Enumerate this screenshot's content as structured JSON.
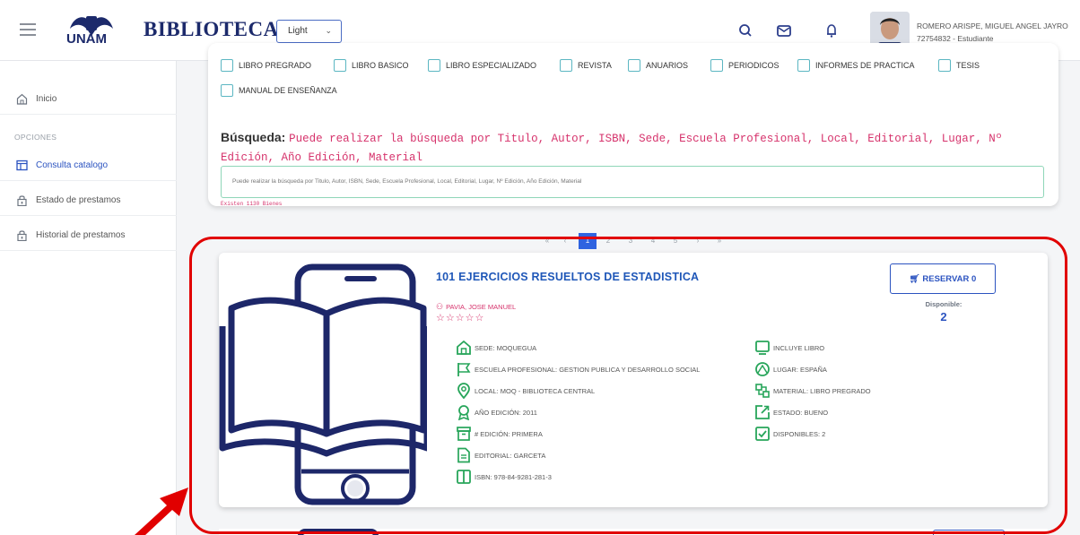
{
  "header": {
    "logo_text": "UNAM",
    "brand": "BIBLIOTECA",
    "theme_select": "Light",
    "user_name": "ROMERO ARISPE, MIGUEL ANGEL JAYRO",
    "user_code": "72754832 - Estudiante"
  },
  "sidebar": {
    "inicio": "Inicio",
    "section": "OPCIONES",
    "items": [
      "Consulta catalogo",
      "Estado de prestamos",
      "Historial de prestamos"
    ]
  },
  "filters": {
    "checkboxes": [
      "LIBRO PREGRADO",
      "LIBRO BASICO",
      "LIBRO ESPECIALIZADO",
      "REVISTA",
      "ANUARIOS",
      "PERIODICOS",
      "INFORMES DE PRACTICA",
      "TESIS",
      "MANUAL DE ENSEÑANZA"
    ],
    "search_label": "Búsqueda:",
    "search_hint": "Puede realizar la búsqueda por Titulo, Autor, ISBN, Sede, Escuela Profesional, Local, Editorial, Lugar, Nº Edición, Año Edición, Material",
    "search_placeholder": "Puede realizar la búsqueda por Titulo, Autor, ISBN, Sede, Escuela Profesional, Local, Editorial, Lugar, Nº Edición, Año Edición, Material",
    "count_text": "Existen 1130 Bienes"
  },
  "pagination": {
    "first": "«",
    "prev": "‹",
    "pages": [
      "1",
      "2",
      "3",
      "4",
      "5"
    ],
    "next": "›",
    "last": "»",
    "active": "1"
  },
  "book": {
    "title": "101 EJERCICIOS RESUELTOS DE ESTADISTICA",
    "author": "PAVIA, JOSE MANUEL",
    "stars": "☆☆☆☆☆",
    "reserve_label": "RESERVAR 0",
    "available_label": "Disponible:",
    "available_count": "2",
    "details_left": [
      "SEDE: MOQUEGUA",
      "ESCUELA PROFESIONAL: GESTION PUBLICA Y DESARROLLO SOCIAL",
      "LOCAL: MOQ - BIBLIOTECA CENTRAL",
      "AÑO EDICIÓN: 2011",
      "# EDICIÓN: PRIMERA",
      "EDITORIAL: GARCETA",
      "ISBN: 978-84-9281-281-3"
    ],
    "details_right": [
      "INCLUYE LIBRO",
      "LUGAR: ESPAÑA",
      "MATERIAL: LIBRO PREGRADO",
      "ESTADO: BUENO",
      "DISPONIBLES: 2"
    ]
  },
  "colors": {
    "primary": "#2b53c0",
    "accent": "#d6336c",
    "navy": "#1d2769",
    "icon_green": "#27a55a",
    "highlight_red": "#e10000"
  }
}
